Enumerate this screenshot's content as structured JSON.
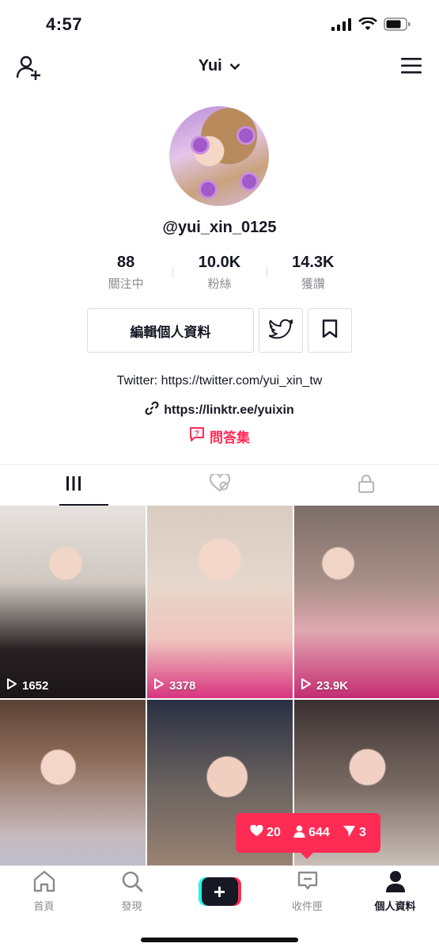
{
  "status_bar": {
    "time": "4:57"
  },
  "header": {
    "title": "Yui"
  },
  "profile": {
    "username": "@yui_xin_0125",
    "stats": [
      {
        "num": "88",
        "label": "關注中"
      },
      {
        "num": "10.0K",
        "label": "粉絲"
      },
      {
        "num": "14.3K",
        "label": "獲讚"
      }
    ],
    "edit_label": "編輯個人資料",
    "bio": "Twitter: https://twitter.com/yui_xin_tw",
    "link": "https://linktr.ee/yuixin",
    "qa_label": "問答集"
  },
  "videos": [
    {
      "views": "1652"
    },
    {
      "views": "3378"
    },
    {
      "views": "23.9K"
    },
    {
      "views": ""
    },
    {
      "views": ""
    },
    {
      "views": ""
    }
  ],
  "bubble": {
    "likes": "20",
    "followers": "644",
    "shares": "3"
  },
  "bottom_nav": [
    {
      "label": "首頁"
    },
    {
      "label": "發現"
    },
    {
      "label": "+"
    },
    {
      "label": "收件匣"
    },
    {
      "label": "個人資料"
    }
  ],
  "colors": {
    "accent": "#fe2c55",
    "cyan": "#25f4ee",
    "text": "#161823"
  }
}
